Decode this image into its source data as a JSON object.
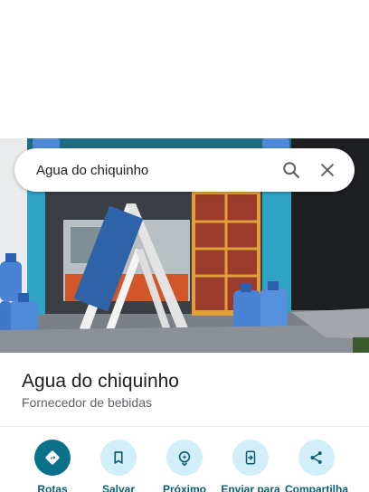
{
  "search": {
    "query": "Agua do chiquinho",
    "search_icon": "search-icon",
    "close_icon": "close-icon"
  },
  "place": {
    "name": "Agua do chiquinho",
    "category": "Fornecedor de bebidas"
  },
  "actions": [
    {
      "label": "Rotas",
      "icon": "directions-icon"
    },
    {
      "label": "Salvar",
      "icon": "bookmark-icon"
    },
    {
      "label": "Próximo",
      "icon": "nearby-icon"
    },
    {
      "label": "Enviar para",
      "icon": "send-to-phone-icon"
    },
    {
      "label": "Compartilha",
      "icon": "share-icon"
    }
  ],
  "colors": {
    "primary": "#0b7189",
    "action_bg": "#d2eef8",
    "action_label": "#0b5e73"
  }
}
